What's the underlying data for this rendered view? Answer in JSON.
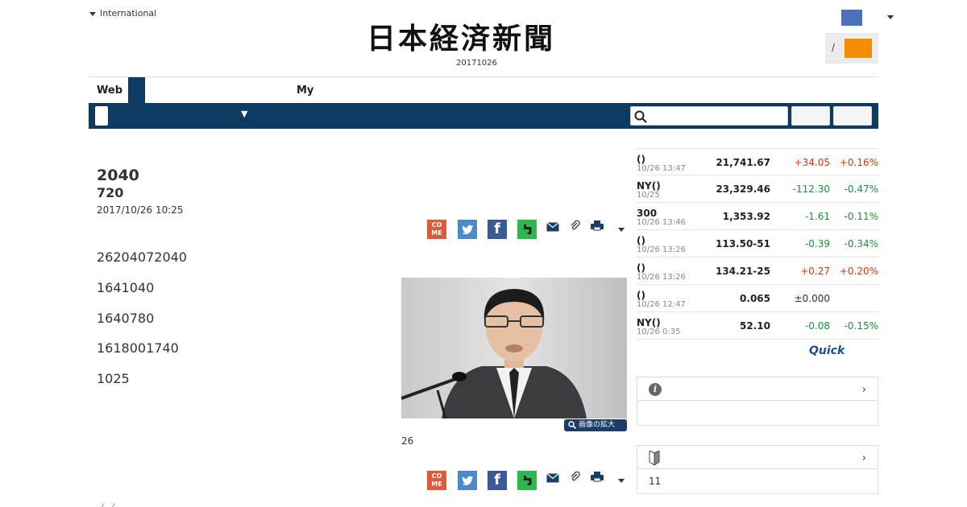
{
  "header": {
    "international_label": "International",
    "logo_text": "日本経済新聞",
    "date": "20171026",
    "login_separator": "/"
  },
  "tabs": {
    "web_label": "Web",
    "my_label": "My"
  },
  "nav": {
    "dropdown_arrow": "▼",
    "search_placeholder": ""
  },
  "article": {
    "title_line1": "2040",
    "title_line2": "720",
    "timestamp": "2017/10/26 10:25",
    "paragraphs": [
      "26204072040",
      "1641040",
      "1640780",
      "1618001740",
      "1025"
    ],
    "photo_caption": "26",
    "zoom_label": "画像の拡大",
    "bottom_hint": "〈 〈"
  },
  "share": {
    "come_label": "CO\nME",
    "facebook_glyph": "f",
    "icons": [
      "come-icon",
      "twitter-icon",
      "facebook-icon",
      "evernote-icon",
      "mail-icon",
      "clip-icon",
      "print-icon",
      "caret-down-icon"
    ]
  },
  "market": {
    "rows": [
      {
        "name": "()",
        "time": "10/26 13:47",
        "value": "21,741.67",
        "change": "+34.05",
        "pct": "+0.16%",
        "dir": "up"
      },
      {
        "name": "NY()",
        "time": "10/25",
        "value": "23,329.46",
        "change": "-112.30",
        "pct": "-0.47%",
        "dir": "down"
      },
      {
        "name": "300",
        "time": "10/26 13:46",
        "value": "1,353.92",
        "change": "-1.61",
        "pct": "-0.11%",
        "dir": "down"
      },
      {
        "name": "()",
        "time": "10/26 13:26",
        "value": "113.50-51",
        "change": "-0.39",
        "pct": "-0.34%",
        "dir": "down"
      },
      {
        "name": "()",
        "time": "10/26 13:26",
        "value": "134.21-25",
        "change": "+0.27",
        "pct": "+0.20%",
        "dir": "up"
      },
      {
        "name": "()",
        "time": "10/26 12:47",
        "value": "0.065",
        "change": "±0.000",
        "pct": "",
        "dir": "flat"
      },
      {
        "name": "NY()",
        "time": "10/26 0:35",
        "value": "52.10",
        "change": "-0.08",
        "pct": "-0.15%",
        "dir": "down"
      }
    ],
    "provider": "Quick"
  },
  "sidebox1": {
    "chevron": "›"
  },
  "sidebox2": {
    "chevron": "›",
    "count": "11"
  },
  "colors": {
    "nav_bg": "#0d3a60",
    "login_button": "#f28c00",
    "up": "#d13a0f",
    "down": "#1a8f3a",
    "user_box": "#4a72b8"
  }
}
